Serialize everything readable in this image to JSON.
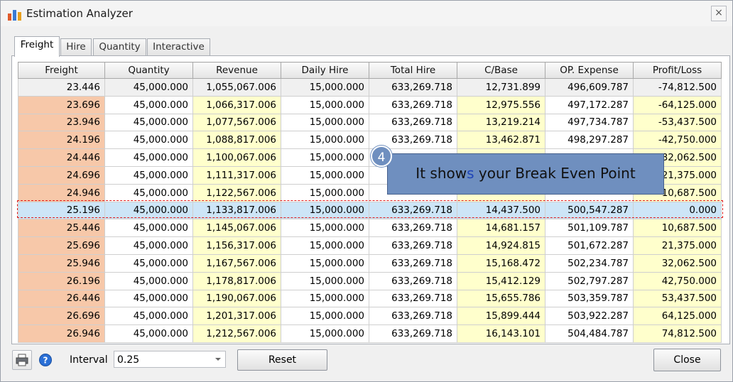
{
  "window": {
    "title": "Estimation Analyzer",
    "close_glyph": "×"
  },
  "tabs": [
    {
      "label": "Freight",
      "active": true
    },
    {
      "label": "Hire",
      "active": false
    },
    {
      "label": "Quantity",
      "active": false
    },
    {
      "label": "Interactive",
      "active": false
    }
  ],
  "grid": {
    "columns": [
      "Freight",
      "Quantity",
      "Revenue",
      "Daily Hire",
      "Total Hire",
      "C/Base",
      "OP. Expense",
      "Profit/Loss"
    ],
    "rows": [
      [
        "23.446",
        "45,000.000",
        "1,055,067.006",
        "15,000.000",
        "633,269.718",
        "12,731.899",
        "496,609.787",
        "-74,812.500"
      ],
      [
        "23.696",
        "45,000.000",
        "1,066,317.006",
        "15,000.000",
        "633,269.718",
        "12,975.556",
        "497,172.287",
        "-64,125.000"
      ],
      [
        "23.946",
        "45,000.000",
        "1,077,567.006",
        "15,000.000",
        "633,269.718",
        "13,219.214",
        "497,734.787",
        "-53,437.500"
      ],
      [
        "24.196",
        "45,000.000",
        "1,088,817.006",
        "15,000.000",
        "633,269.718",
        "13,462.871",
        "498,297.287",
        "-42,750.000"
      ],
      [
        "24.446",
        "45,000.000",
        "1,100,067.006",
        "15,000.000",
        "",
        "",
        "",
        "-32,062.500"
      ],
      [
        "24.696",
        "45,000.000",
        "1,111,317.006",
        "15,000.000",
        "",
        "",
        "",
        "-21,375.000"
      ],
      [
        "24.946",
        "45,000.000",
        "1,122,567.006",
        "15,000.000",
        "",
        "",
        "",
        "-10,687.500"
      ],
      [
        "25.196",
        "45,000.000",
        "1,133,817.006",
        "15,000.000",
        "633,269.718",
        "14,437.500",
        "500,547.287",
        "0.000"
      ],
      [
        "25.446",
        "45,000.000",
        "1,145,067.006",
        "15,000.000",
        "633,269.718",
        "14,681.157",
        "501,109.787",
        "10,687.500"
      ],
      [
        "25.696",
        "45,000.000",
        "1,156,317.006",
        "15,000.000",
        "633,269.718",
        "14,924.815",
        "501,672.287",
        "21,375.000"
      ],
      [
        "25.946",
        "45,000.000",
        "1,167,567.006",
        "15,000.000",
        "633,269.718",
        "15,168.472",
        "502,234.787",
        "32,062.500"
      ],
      [
        "26.196",
        "45,000.000",
        "1,178,817.006",
        "15,000.000",
        "633,269.718",
        "15,412.129",
        "502,797.287",
        "42,750.000"
      ],
      [
        "26.446",
        "45,000.000",
        "1,190,067.006",
        "15,000.000",
        "633,269.718",
        "15,655.786",
        "503,359.787",
        "53,437.500"
      ],
      [
        "26.696",
        "45,000.000",
        "1,201,317.006",
        "15,000.000",
        "633,269.718",
        "15,899.444",
        "503,922.287",
        "64,125.000"
      ],
      [
        "26.946",
        "45,000.000",
        "1,212,567.006",
        "15,000.000",
        "633,269.718",
        "16,143.101",
        "504,484.787",
        "74,812.500"
      ]
    ],
    "highlight_row": 7
  },
  "callout": {
    "step": "4",
    "text_before": "It show",
    "text_blue": "s",
    "text_after": " your Break Even Point"
  },
  "footer": {
    "print_icon": "printer-icon",
    "help_icon": "help-icon",
    "interval_label": "Interval",
    "interval_value": "0.25",
    "reset_label": "Reset",
    "close_label": "Close"
  },
  "colors": {
    "freight_column": "#f7c8a9",
    "yellow_column": "#ffffcc",
    "highlight_row": "#cde5f7",
    "dashed_border": "#e01b1b",
    "callout": "#6f8fbf"
  }
}
